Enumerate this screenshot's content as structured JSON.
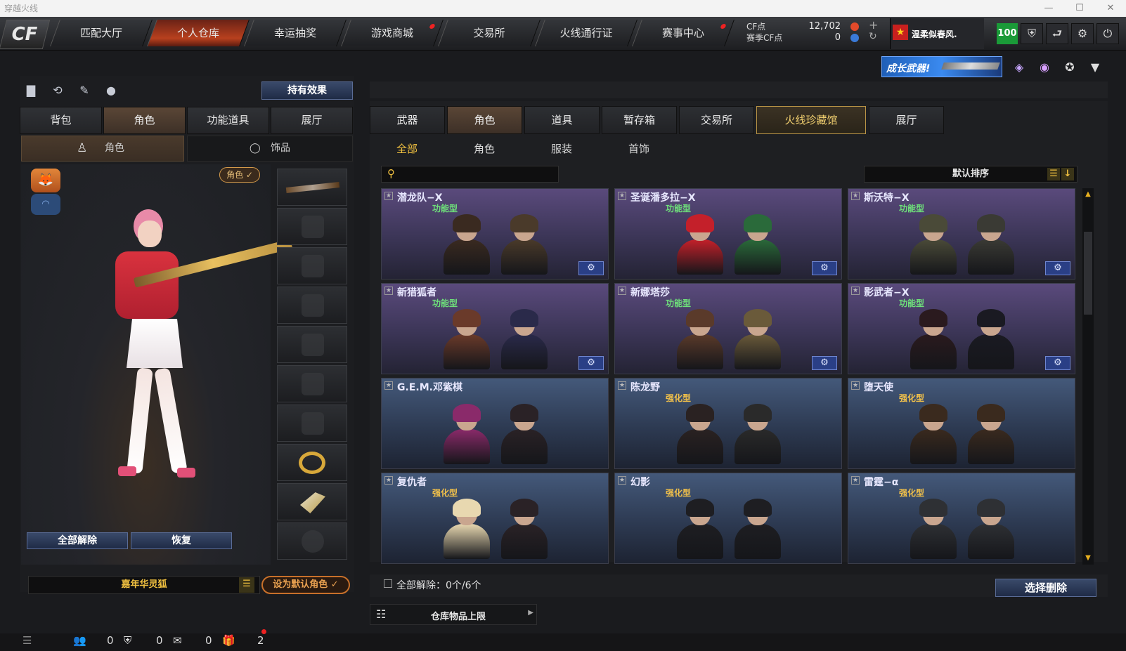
{
  "window": {
    "title": "穿越火线"
  },
  "nav": {
    "tabs": [
      "匹配大厅",
      "个人仓库",
      "幸运抽奖",
      "游戏商城",
      "交易所",
      "火线通行证",
      "赛事中心"
    ],
    "cf_label": "CF点",
    "cf_value": "12,702",
    "season_cf_label": "赛季CF点",
    "season_cf_value": "0",
    "username": "温柔似春风.",
    "level": "100"
  },
  "banner": {
    "text": "成长武器!"
  },
  "left": {
    "effects_button": "持有效果",
    "tabs": [
      "背包",
      "角色",
      "功能道具",
      "展厅"
    ],
    "subtabs": [
      "角色",
      "饰品"
    ],
    "role_badge": "角色 ✓",
    "clear_all": "全部解除",
    "restore": "恢复",
    "character_name": "嘉年华灵狐",
    "set_default": "设为默认角色 ✓"
  },
  "right": {
    "tabs": [
      "武器",
      "角色",
      "道具",
      "暂存箱",
      "交易所",
      "火线珍藏馆",
      "展厅"
    ],
    "subtabs": [
      "全部",
      "角色",
      "服装",
      "首饰"
    ],
    "sort_label": "默认排序",
    "cards": [
      {
        "name": "潜龙队−X",
        "type": "功能型",
        "style": "func",
        "gear": true
      },
      {
        "name": "圣诞潘多拉−X",
        "type": "功能型",
        "style": "func",
        "gear": true
      },
      {
        "name": "斯沃特−X",
        "type": "功能型",
        "style": "func",
        "gear": true
      },
      {
        "name": "新猎狐者",
        "type": "功能型",
        "style": "func",
        "gear": true
      },
      {
        "name": "新娜塔莎",
        "type": "功能型",
        "style": "func",
        "gear": true
      },
      {
        "name": "影武者−X",
        "type": "功能型",
        "style": "func",
        "gear": true
      },
      {
        "name": "G.E.M.邓紫棋",
        "type": "",
        "style": "enh",
        "gear": false
      },
      {
        "name": "陈龙野",
        "type": "强化型",
        "style": "enh",
        "gear": false
      },
      {
        "name": "堕天使",
        "type": "强化型",
        "style": "enh",
        "gear": false
      },
      {
        "name": "复仇者",
        "type": "强化型",
        "style": "enh",
        "gear": false
      },
      {
        "name": "幻影",
        "type": "强化型",
        "style": "enh",
        "gear": false
      },
      {
        "name": "雷霆−α",
        "type": "强化型",
        "style": "enh",
        "gear": false
      }
    ],
    "clear_all_label": "全部解除：0个/6个",
    "select_delete": "选择删除",
    "storage_limit": "仓库物品上限"
  },
  "bottom": {
    "count1": "0",
    "count2": "0",
    "count3": "0",
    "count4": "2"
  },
  "colors": {
    "accent": "#b8401e",
    "func_green": "#6ee07a",
    "enh_gold": "#f2c14a",
    "level_green": "#1a9a38"
  }
}
